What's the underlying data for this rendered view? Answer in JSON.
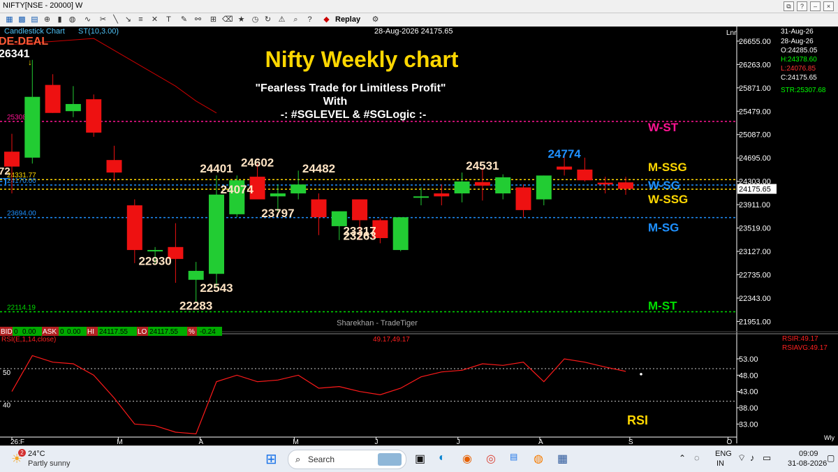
{
  "window": {
    "title": "NIFTY[NSE - 20000] W",
    "controls": [
      "⧉",
      "?",
      "–",
      "×"
    ]
  },
  "toolbar": {
    "replay_label": "Replay"
  },
  "chart_header": {
    "type_label": "Candlestick Chart",
    "indicator_label": "ST(10,3.00)",
    "date_price": "28-Aug-2026 24175.65",
    "scale_label": "Lnr"
  },
  "ohlc_panel": {
    "date1": "31-Aug-26",
    "date2": "28-Aug-26",
    "open": "O:24285.05",
    "high": "H:24378.60",
    "low": "L:24076.85",
    "close": "C:24175.65",
    "str": "STR:25307.68"
  },
  "annotations": {
    "title": "Nifty Weekly chart",
    "tagline1": "\"Fearless Trade for Limitless Profit\"",
    "tagline2": "With",
    "tagline3": "-: #SGLEVEL & #SGLogic :-",
    "deal_label": "DE-DEAL",
    "high_label": "26341",
    "watermark": "Sharekhan - TradeTiger",
    "rsi_label": "RSI"
  },
  "levels": [
    {
      "name": "W-ST",
      "value": "25308.00",
      "y": 25308,
      "color": "#ff1493"
    },
    {
      "name": "M-SSG",
      "value": "24331.77",
      "y": 24331.77,
      "color": "#ffd700"
    },
    {
      "name": "W-SG",
      "value": "24170.00",
      "y": 24240,
      "color": "#1e90ff"
    },
    {
      "name": "W-SSG",
      "value": "",
      "y": 24170,
      "color": "#ffd700"
    },
    {
      "name": "M-SG",
      "value": "23694.00",
      "y": 23694,
      "color": "#1e90ff"
    },
    {
      "name": "M-ST",
      "value": "22114.19",
      "y": 22114.19,
      "color": "#00dd00"
    }
  ],
  "edge_labels": {
    "left_72": "72",
    "left_ft": "FT"
  },
  "quote_bar": {
    "bid_label": "BID",
    "bid": "0",
    "bid_val": "0.00",
    "ask_label": "ASK",
    "ask": "0",
    "ask_val": "0.00",
    "hi_label": "HI",
    "hi": "24117.55",
    "lo_label": "LO",
    "lo": "24117.55",
    "pct_label": "%",
    "pct": "-0.24"
  },
  "rsi_header": {
    "name": "RSI(E,1,14,close)",
    "values": "49.17,49.17",
    "rsir": "RSIR:49.17",
    "rsiavg": "RSIAVG:49.17"
  },
  "price_axis": [
    "26655.00",
    "26263.00",
    "25871.00",
    "25479.00",
    "25087.00",
    "24695.00",
    "24303.00",
    "23911.00",
    "23519.00",
    "23127.00",
    "22735.00",
    "22343.00",
    "21951.00"
  ],
  "current_price_tag": "24175.65",
  "rsi_axis": [
    "53.00",
    "48.00",
    "43.00",
    "38.00",
    "33.00"
  ],
  "rsi_left_levels": [
    "50",
    "40"
  ],
  "x_axis": [
    "26:F",
    "M",
    "A",
    "M",
    "J",
    "J",
    "A",
    "S",
    "O"
  ],
  "x_axis_right": "Wly",
  "chart_data": {
    "type": "candlestick",
    "ylim": [
      21780,
      26900
    ],
    "candles": [
      {
        "o": 24800,
        "h": 25100,
        "l": 24100,
        "c": 24550
      },
      {
        "o": 24700,
        "h": 26341,
        "l": 24600,
        "c": 25720
      },
      {
        "o": 25920,
        "h": 26100,
        "l": 25450,
        "c": 25450
      },
      {
        "o": 25480,
        "h": 25900,
        "l": 25380,
        "c": 25600
      },
      {
        "o": 25680,
        "h": 25760,
        "l": 25050,
        "c": 25120
      },
      {
        "o": 24660,
        "h": 24900,
        "l": 24300,
        "c": 24450
      },
      {
        "o": 23900,
        "h": 24000,
        "l": 22930,
        "c": 23150
      },
      {
        "o": 23150,
        "h": 23200,
        "l": 22930,
        "c": 23150
      },
      {
        "o": 23200,
        "h": 23600,
        "l": 22600,
        "c": 23000
      },
      {
        "o": 22650,
        "h": 22950,
        "l": 22283,
        "c": 22800
      },
      {
        "o": 22750,
        "h": 24401,
        "l": 22543,
        "c": 24080
      },
      {
        "o": 23750,
        "h": 24401,
        "l": 23700,
        "c": 24320
      },
      {
        "o": 24380,
        "h": 24602,
        "l": 24000,
        "c": 24000
      },
      {
        "o": 24050,
        "h": 24250,
        "l": 23797,
        "c": 24100
      },
      {
        "o": 24100,
        "h": 24482,
        "l": 24000,
        "c": 24250
      },
      {
        "o": 24000,
        "h": 24100,
        "l": 23400,
        "c": 23700
      },
      {
        "o": 23550,
        "h": 23800,
        "l": 23317,
        "c": 23800
      },
      {
        "o": 24000,
        "h": 24000,
        "l": 23317,
        "c": 23650
      },
      {
        "o": 23650,
        "h": 23680,
        "l": 23263,
        "c": 23350
      },
      {
        "o": 23150,
        "h": 23700,
        "l": 23130,
        "c": 23700
      },
      {
        "o": 24050,
        "h": 24200,
        "l": 23900,
        "c": 24050
      },
      {
        "o": 24100,
        "h": 24250,
        "l": 23900,
        "c": 24050
      },
      {
        "o": 24100,
        "h": 24450,
        "l": 23950,
        "c": 24300
      },
      {
        "o": 24290,
        "h": 24531,
        "l": 23980,
        "c": 24230
      },
      {
        "o": 24100,
        "h": 24420,
        "l": 24000,
        "c": 24370
      },
      {
        "o": 24200,
        "h": 24250,
        "l": 23700,
        "c": 23820
      },
      {
        "o": 24000,
        "h": 24400,
        "l": 23900,
        "c": 24400
      },
      {
        "o": 24550,
        "h": 24774,
        "l": 24400,
        "c": 24500
      },
      {
        "o": 24500,
        "h": 24700,
        "l": 24300,
        "c": 24320
      },
      {
        "o": 24280,
        "h": 24380,
        "l": 24100,
        "c": 24250
      },
      {
        "o": 24285,
        "h": 24378.6,
        "l": 24076.85,
        "c": 24175.65
      }
    ],
    "price_labels": [
      {
        "text": "22930",
        "bar": 7,
        "y": 22900,
        "color": "#ffe4c4"
      },
      {
        "text": "22543",
        "bar": 10,
        "y": 22450,
        "color": "#ffe4c4"
      },
      {
        "text": "22283",
        "bar": 9,
        "y": 22150,
        "color": "#ffe4c4"
      },
      {
        "text": "24401",
        "bar": 10,
        "y": 24450,
        "color": "#ffe4c4"
      },
      {
        "text": "24602",
        "bar": 12,
        "y": 24550,
        "color": "#ffe4c4"
      },
      {
        "text": "24074",
        "bar": 11,
        "y": 24100,
        "color": "#ffe4c4"
      },
      {
        "text": "24482",
        "bar": 15,
        "y": 24450,
        "color": "#ffe4c4"
      },
      {
        "text": "23797",
        "bar": 13,
        "y": 23700,
        "color": "#ffe4c4"
      },
      {
        "text": "23317",
        "bar": 17,
        "y": 23400,
        "color": "#ffe4c4"
      },
      {
        "text": "23263",
        "bar": 17,
        "y": 23320,
        "color": "#ffe4c4"
      },
      {
        "text": "24531",
        "bar": 23,
        "y": 24500,
        "color": "#ffe4c4"
      },
      {
        "text": "24774",
        "bar": 27,
        "y": 24700,
        "color": "#1e90ff"
      }
    ],
    "supertrend": [
      [
        0,
        26600
      ],
      [
        4,
        26700
      ],
      [
        6,
        26300
      ],
      [
        8,
        25900
      ],
      [
        9,
        25650
      ],
      [
        10,
        25450
      ]
    ],
    "rsi": {
      "ylim": [
        29,
        56
      ],
      "values": [
        43,
        54,
        52,
        51.5,
        48,
        41,
        33,
        32.5,
        30.5,
        30,
        46,
        48,
        46,
        46.5,
        48,
        44,
        44.5,
        43,
        42,
        44,
        47.5,
        49,
        49.5,
        51.5,
        51,
        52,
        46,
        53,
        52,
        50.5,
        49.17
      ]
    }
  },
  "taskbar": {
    "weather_temp": "24°C",
    "weather_desc": "Partly sunny",
    "weather_badge": "2",
    "search_placeholder": "Search",
    "lang1": "ENG",
    "lang2": "IN",
    "time": "09:09",
    "date": "31-08-2026"
  }
}
